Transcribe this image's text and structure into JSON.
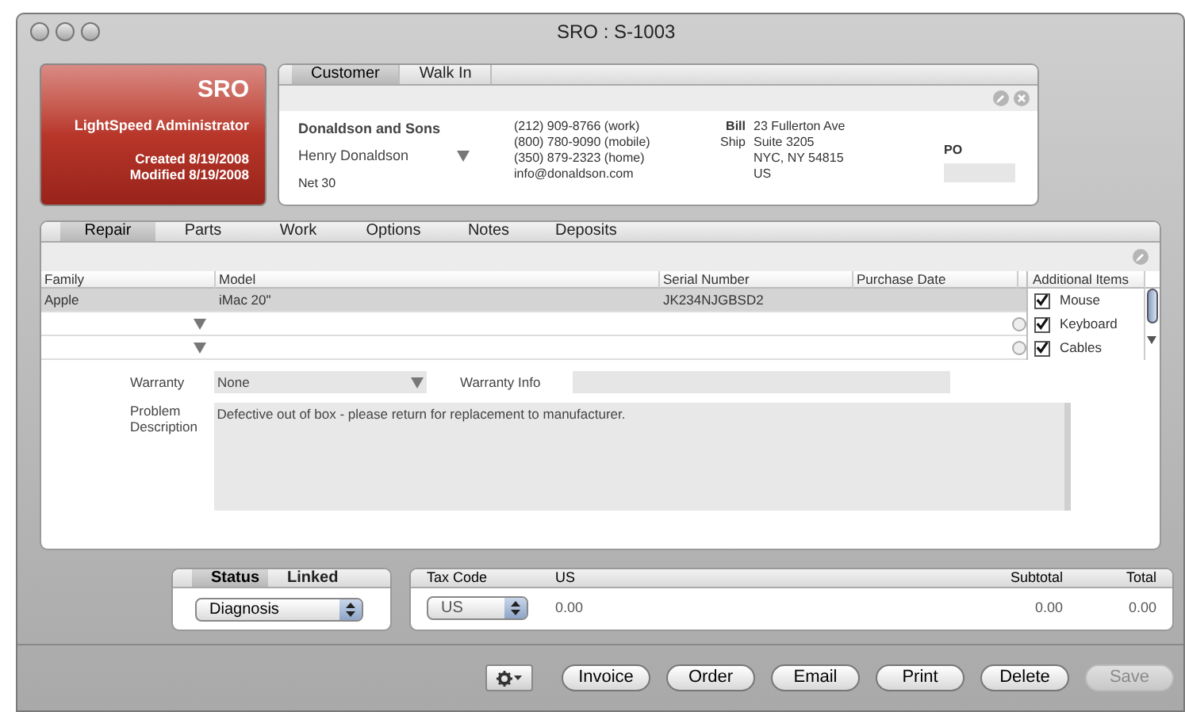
{
  "window": {
    "title": "SRO : S-1003"
  },
  "summary": {
    "title": "SRO",
    "user": "LightSpeed Administrator",
    "created": "Created 8/19/2008",
    "modified": "Modified 8/19/2008"
  },
  "customer": {
    "tabs": [
      {
        "label": "Customer",
        "selected": true
      },
      {
        "label": "Walk In",
        "selected": false
      }
    ],
    "company": "Donaldson and Sons",
    "contact": "Henry Donaldson",
    "terms": "Net 30",
    "phones": [
      "(212) 909-8766 (work)",
      "(800) 780-9090 (mobile)",
      "(350) 879-2323 (home)",
      "info@donaldson.com"
    ],
    "bill_label": "Bill",
    "ship_label": "Ship",
    "address": [
      "23 Fullerton Ave",
      "Suite 3205",
      "NYC, NY 54815",
      "US"
    ],
    "po_label": "PO"
  },
  "repair": {
    "tabs": [
      {
        "label": "Repair",
        "selected": true
      },
      {
        "label": "Parts",
        "selected": false
      },
      {
        "label": "Work",
        "selected": false
      },
      {
        "label": "Options",
        "selected": false
      },
      {
        "label": "Notes",
        "selected": false
      },
      {
        "label": "Deposits",
        "selected": false
      }
    ],
    "columns": [
      "Family",
      "Model",
      "Serial Number",
      "Purchase Date",
      "Additional Items"
    ],
    "rows": [
      {
        "kind": "item",
        "selected": true,
        "family": "Apple",
        "model": "iMac 20\"",
        "serial": "JK234NJGBSD2"
      },
      {
        "kind": "blank",
        "selected": false
      },
      {
        "kind": "blank",
        "selected": false
      }
    ],
    "additional_items": [
      {
        "label": "Mouse",
        "checked": true
      },
      {
        "label": "Keyboard",
        "checked": true
      },
      {
        "label": "Cables",
        "checked": true
      }
    ],
    "warranty_label": "Warranty",
    "warranty_value": "None",
    "warranty_info_label": "Warranty Info",
    "problem_label": "Problem Description",
    "problem_value": "Defective out of box - please return for replacement to manufacturer."
  },
  "status": {
    "tabs": [
      {
        "label": "Status",
        "selected": true
      },
      {
        "label": "Linked",
        "selected": false
      }
    ],
    "value": "Diagnosis"
  },
  "tax": {
    "headers": [
      "Tax Code",
      "US",
      "Subtotal",
      "Total"
    ],
    "tax_code": "US",
    "us": "0.00",
    "subtotal": "0.00",
    "total": "0.00"
  },
  "buttons": [
    {
      "label": "Invoice",
      "disabled": false
    },
    {
      "label": "Order",
      "disabled": false
    },
    {
      "label": "Email",
      "disabled": false
    },
    {
      "label": "Print",
      "disabled": false
    },
    {
      "label": "Delete",
      "disabled": false
    },
    {
      "label": "Save",
      "disabled": true
    }
  ]
}
